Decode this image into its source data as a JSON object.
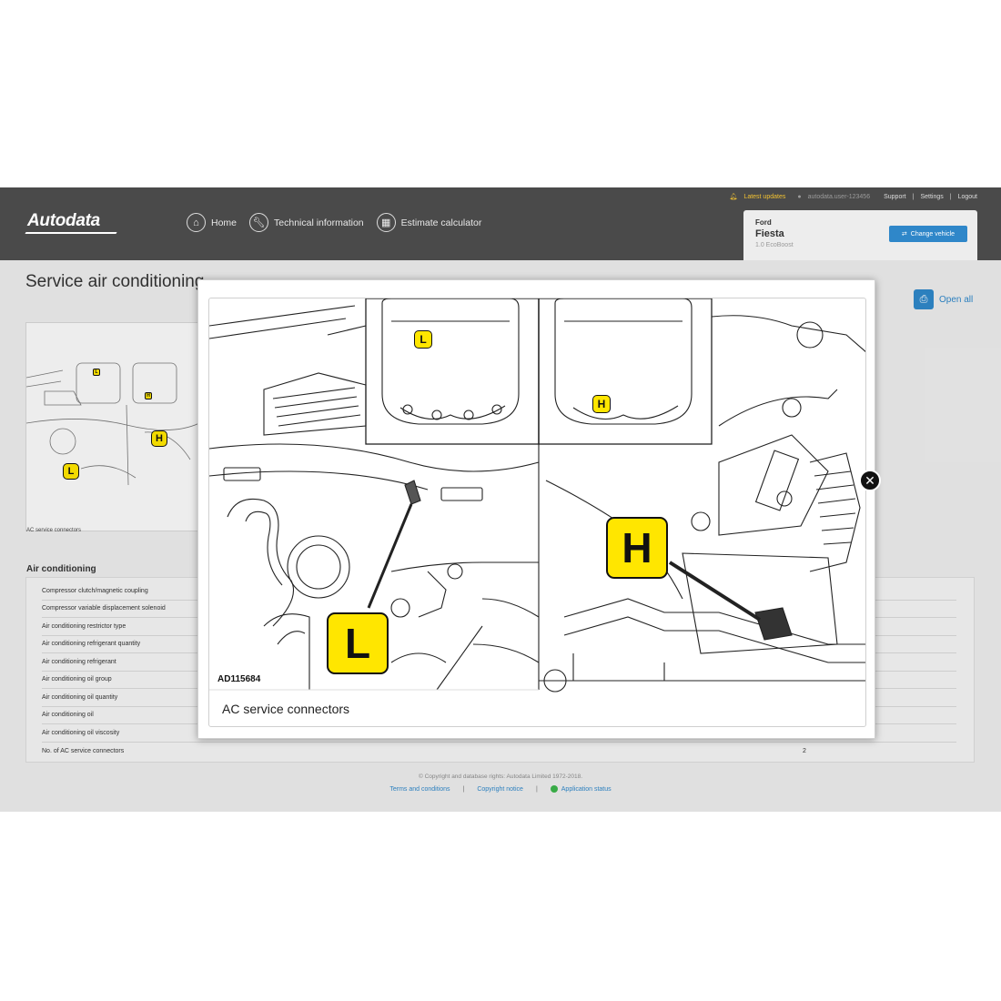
{
  "header": {
    "logo_text": "Autodata",
    "topbar": {
      "latest_updates": "Latest updates",
      "user": "autodata.user-123456",
      "support": "Support",
      "settings": "Settings",
      "logout": "Logout",
      "separator": "|"
    },
    "nav": [
      {
        "label": "Home",
        "icon": "home-icon"
      },
      {
        "label": "Technical information",
        "icon": "wrench-icon"
      },
      {
        "label": "Estimate calculator",
        "icon": "calculator-icon"
      }
    ],
    "vehicle": {
      "make": "Ford",
      "model": "Fiesta",
      "engine": "1.0 EcoBoost",
      "change_label": "Change vehicle"
    }
  },
  "page": {
    "title": "Service air conditioning",
    "open_all_label": "Open all",
    "thumbnail_caption": "AC service connectors",
    "section_title": "Air conditioning",
    "specs": [
      {
        "label": "Compressor clutch/magnetic coupling",
        "value": ""
      },
      {
        "label": "Compressor variable displacement solenoid",
        "value": ""
      },
      {
        "label": "Air conditioning restrictor type",
        "value": ""
      },
      {
        "label": "Air conditioning refrigerant quantity",
        "value": ""
      },
      {
        "label": "Air conditioning refrigerant",
        "value": ""
      },
      {
        "label": "Air conditioning oil group",
        "value": ""
      },
      {
        "label": "Air conditioning oil quantity",
        "value": ""
      },
      {
        "label": "Air conditioning oil",
        "value": ""
      },
      {
        "label": "Air conditioning oil viscosity",
        "value": ""
      },
      {
        "label": "No. of AC service connectors",
        "value": "2"
      }
    ],
    "footer": {
      "copyright": "© Copyright and database rights: Autodata Limited 1972-2018.",
      "terms": "Terms and conditions",
      "copyright_notice": "Copyright notice",
      "app_status": "Application status",
      "separator": "|"
    }
  },
  "modal": {
    "close_symbol": "✕",
    "figure_code": "AD115684",
    "caption": "AC service connectors",
    "labels": {
      "low": "L",
      "high": "H"
    }
  },
  "colors": {
    "header_bg": "#4a4a4a",
    "accent": "#2f87c9",
    "highlight": "#ffe600",
    "status_ok": "#3cb44a"
  }
}
